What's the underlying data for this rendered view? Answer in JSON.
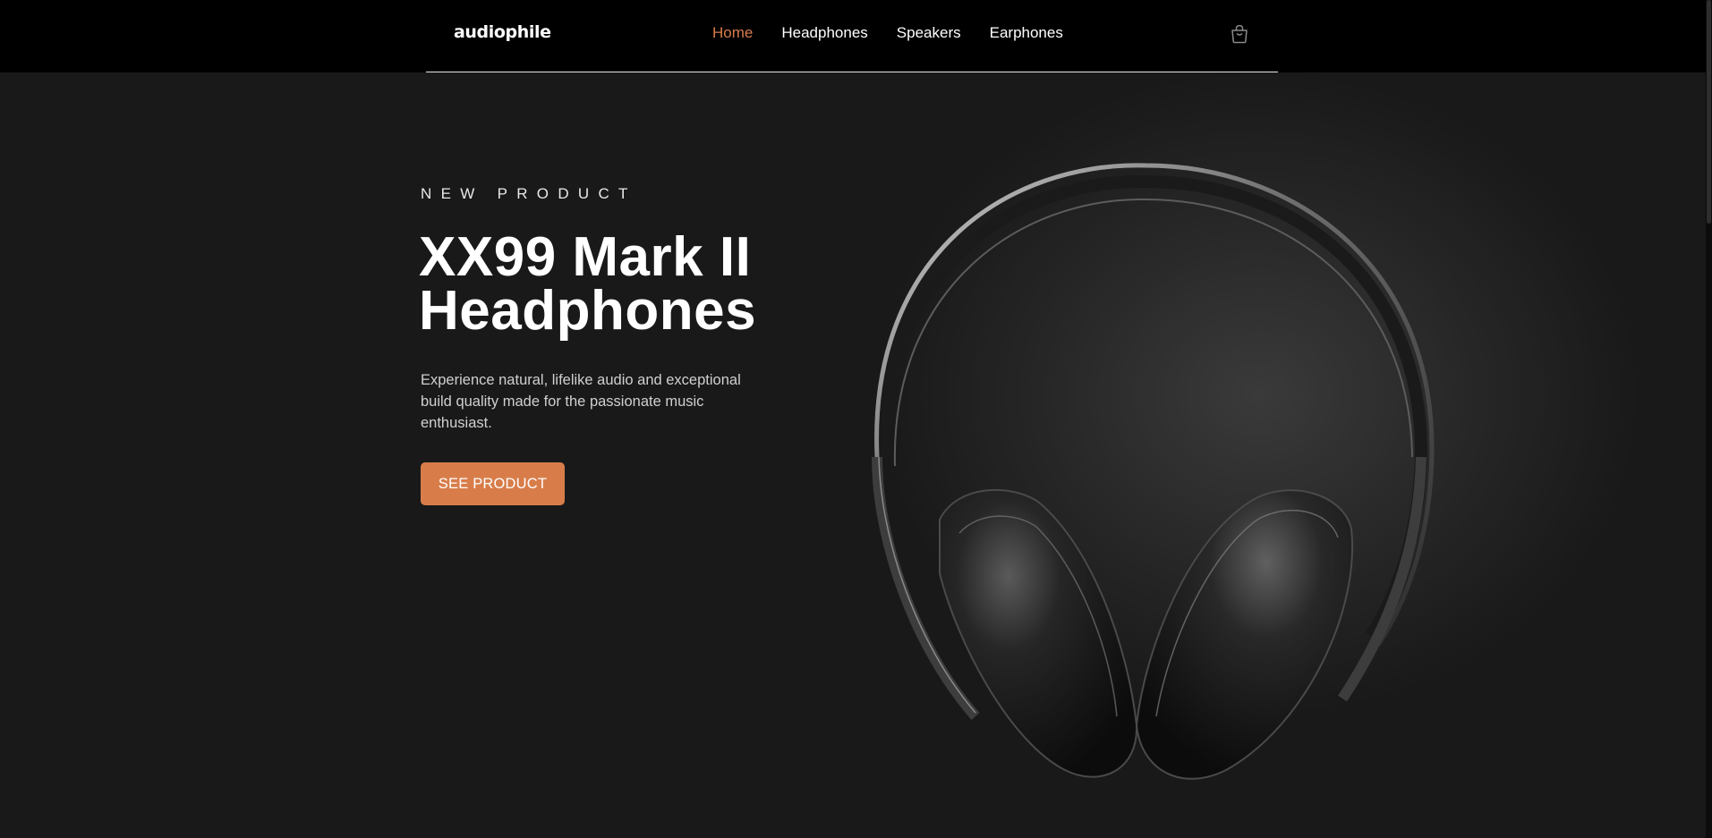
{
  "brand": {
    "logo_text": "audiophile",
    "accent_color": "#d87d4a"
  },
  "nav": {
    "items": [
      {
        "label": "Home",
        "active": true
      },
      {
        "label": "Headphones",
        "active": false
      },
      {
        "label": "Speakers",
        "active": false
      },
      {
        "label": "Earphones",
        "active": false
      }
    ],
    "cart_icon": "shopping-bag-icon"
  },
  "hero": {
    "overline": "NEW PRODUCT",
    "title_line1": "XX99 Mark II",
    "title_line2": "Headphones",
    "description": "Experience natural, lifelike audio and exceptional build quality made for the passionate music enthusiast.",
    "cta_label": "SEE PRODUCT",
    "image": "headphones-product-image"
  }
}
